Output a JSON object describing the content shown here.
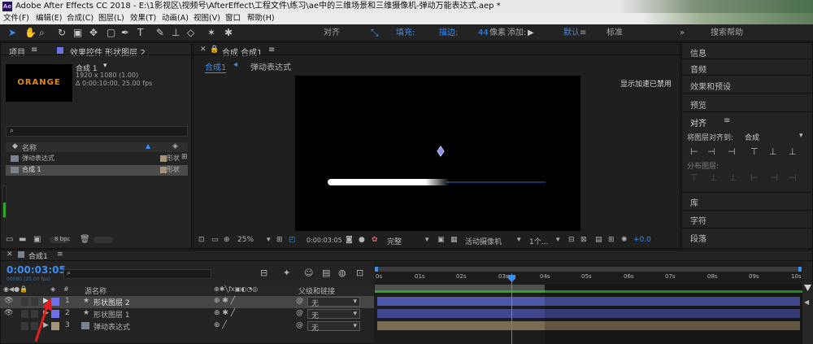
{
  "window": {
    "app_icon": "Ae",
    "title": "Adobe After Effects CC 2018 - E:\\1影视区\\视频号\\AfterEffect\\工程文件\\练习\\ae中的三维场景和三维摄像机-弹动万能表达式.aep *"
  },
  "menu": [
    "文件(F)",
    "编辑(E)",
    "合成(C)",
    "图层(L)",
    "效果(T)",
    "动画(A)",
    "视图(V)",
    "窗口",
    "帮助(H)"
  ],
  "toolbar": {
    "align_label": "对齐",
    "fill_label": "填充:",
    "stroke_label": "描边:",
    "stroke_value": "44",
    "stroke_unit": "像素",
    "add_label": "添加:",
    "workspace_default": "默认",
    "workspace_standard": "标准",
    "search_placeholder": "搜索帮助"
  },
  "project": {
    "tab_project": "项目",
    "tab_effects": "效果控件 形状图层 2",
    "comp_name": "合成 1",
    "comp_info1": "1920 x 1080 (1.00)",
    "comp_info2": "Δ 0:00:10:00, 25.00 fps",
    "thumb_text": "ORANGE",
    "col_name": "名称",
    "items": [
      {
        "name": "弹动表达式",
        "type": "形状"
      },
      {
        "name": "合成 1",
        "type": "形状"
      }
    ],
    "bpc": "8 bpc"
  },
  "viewer": {
    "tab_label": "合成 合成1",
    "sub_comp": "合成1",
    "sub_expr": "弹动表达式",
    "accel_msg": "显示加速已禁用",
    "zoom": "25%",
    "time": "0:00:03:05",
    "quality": "完整",
    "camera": "活动摄像机",
    "views": "1个...",
    "exposure": "+0.0"
  },
  "right_panels": {
    "info": "信息",
    "audio": "音频",
    "effects_presets": "效果和预设",
    "preview": "预览",
    "align": "对齐",
    "align_to_label": "将图层对齐到:",
    "align_to_value": "合成",
    "distribute": "分布图层:",
    "library": "库",
    "character": "字符",
    "paragraph": "段落"
  },
  "timeline": {
    "tab_label": "合成1",
    "timecode": "0:00:03:05",
    "fps_sub": "00080 (25.00 fps)",
    "col_name": "源名称",
    "col_parent": "父级和链接",
    "ticks": [
      "0s",
      "01s",
      "02s",
      "03s",
      "04s",
      "05s",
      "06s",
      "07s",
      "08s",
      "09s",
      "10s"
    ],
    "layers": [
      {
        "num": "1",
        "name": "形状图层 2",
        "parent": "无",
        "color": "#6f6fe8"
      },
      {
        "num": "2",
        "name": "形状图层 1",
        "parent": "无",
        "color": "#6f6fe8"
      },
      {
        "num": "3",
        "name": "弹动表达式",
        "parent": "无",
        "color": "#a49478"
      }
    ]
  }
}
